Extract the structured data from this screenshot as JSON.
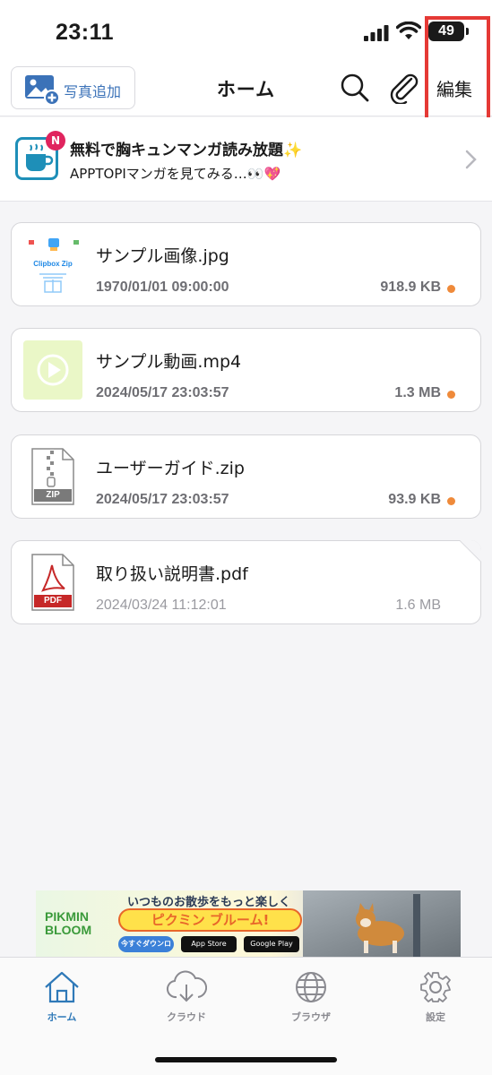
{
  "status_bar": {
    "time": "23:11",
    "battery": "49"
  },
  "header": {
    "add_photo_label": "写真追加",
    "title": "ホーム",
    "edit_label": "編集"
  },
  "promo": {
    "badge": "N",
    "title": "無料で胸キュンマンガ読み放題✨",
    "subtitle": "APPTOPIマンガを見てみる…👀💖"
  },
  "files": [
    {
      "name": "サンプル画像.jpg",
      "date": "1970/01/01 09:00:00",
      "size": "918.9 KB",
      "thumb_label": "Clipbox Zip"
    },
    {
      "name": "サンプル動画.mp4",
      "date": "2024/05/17 23:03:57",
      "size": "1.3 MB"
    },
    {
      "name": "ユーザーガイド.zip",
      "date": "2024/05/17 23:03:57",
      "size": "93.9 KB",
      "thumb_label": "ZIP"
    },
    {
      "name": "取り扱い説明書.pdf",
      "date": "2024/03/24 11:12:01",
      "size": "1.6 MB",
      "thumb_label": "PDF"
    }
  ],
  "ad": {
    "brand": "PIKMIN BLOOM",
    "tagline": "いつものお散歩をもっと楽しく",
    "headline": "ピクミン ブルーム!",
    "cta": "今すぐダウンロード!",
    "store_apple": "App Store",
    "store_google": "Google Play"
  },
  "tabs": [
    {
      "label": "ホーム",
      "icon": "home-icon",
      "active": true
    },
    {
      "label": "クラウド",
      "icon": "cloud-download-icon",
      "active": false
    },
    {
      "label": "ブラウザ",
      "icon": "globe-icon",
      "active": false
    },
    {
      "label": "設定",
      "icon": "gear-icon",
      "active": false
    }
  ],
  "colors": {
    "accent": "#2f79b8",
    "highlight_box": "#e53935",
    "status_dot": "#ef8a3a",
    "badge": "#e0245e"
  }
}
